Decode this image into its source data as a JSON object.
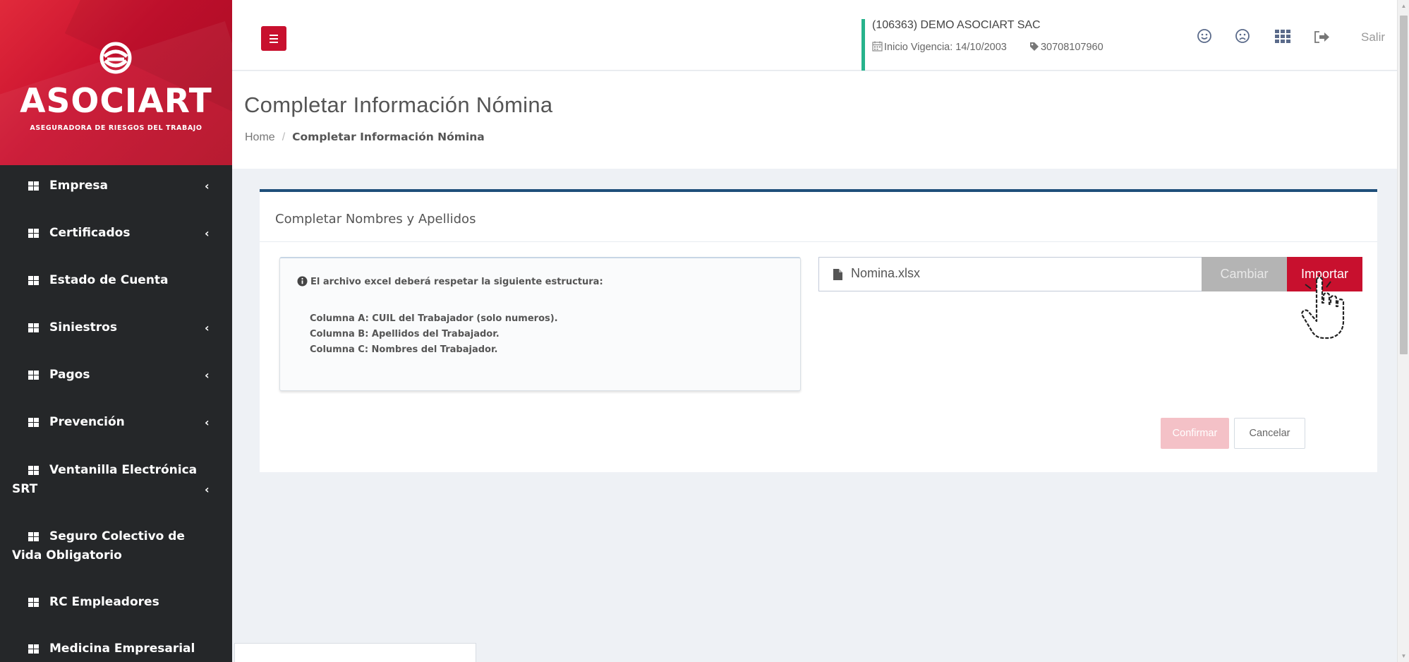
{
  "brand": {
    "name": "ASOCIART",
    "tagline": "ASEGURADORA DE RIESGOS DEL TRABAJO",
    "color": "#c8102e"
  },
  "sidebar": {
    "items": [
      {
        "label": "Empresa",
        "has_submenu": true
      },
      {
        "label": "Certificados",
        "has_submenu": true
      },
      {
        "label": "Estado de Cuenta",
        "has_submenu": false
      },
      {
        "label": "Siniestros",
        "has_submenu": true
      },
      {
        "label": "Pagos",
        "has_submenu": true
      },
      {
        "label": "Prevención",
        "has_submenu": true
      },
      {
        "label": "Ventanilla Electrónica SRT",
        "has_submenu": true
      },
      {
        "label": "Seguro Colectivo de Vida Obligatorio",
        "has_submenu": false
      },
      {
        "label": "RC Empleadores",
        "has_submenu": false
      },
      {
        "label": "Medicina Empresarial",
        "has_submenu": false
      }
    ]
  },
  "header": {
    "company_name": "(106363) DEMO ASOCIART SAC",
    "vigencia": "Inicio Vigencia: 14/10/2003",
    "cuit": "30708107960",
    "logout_label": "Salir",
    "icons": [
      "menu-icon",
      "smile-icon",
      "frown-icon",
      "apps-grid-icon",
      "logout-icon"
    ]
  },
  "page": {
    "title": "Completar Información Nómina",
    "breadcrumb": {
      "home": "Home",
      "separator": "/",
      "current": "Completar Información Nómina"
    }
  },
  "panel": {
    "title": "Completar Nombres y Apellidos",
    "info": {
      "lead": "El archivo excel deberá respetar la siguiente estructura:",
      "lines": [
        "Columna A: CUIL del Trabajador (solo numeros).",
        "Columna B: Apellidos del Trabajador.",
        "Columna C: Nombres del Trabajador."
      ]
    },
    "file": {
      "name": "Nomina.xlsx",
      "change_label": "Cambiar",
      "import_label": "Importar"
    },
    "actions": {
      "confirm_label": "Confirmar",
      "cancel_label": "Cancelar"
    }
  },
  "colors": {
    "accent_red": "#c8102e",
    "sidebar_bg": "#252729",
    "panel_border": "#1f4f7a",
    "company_border": "#27b38c"
  }
}
